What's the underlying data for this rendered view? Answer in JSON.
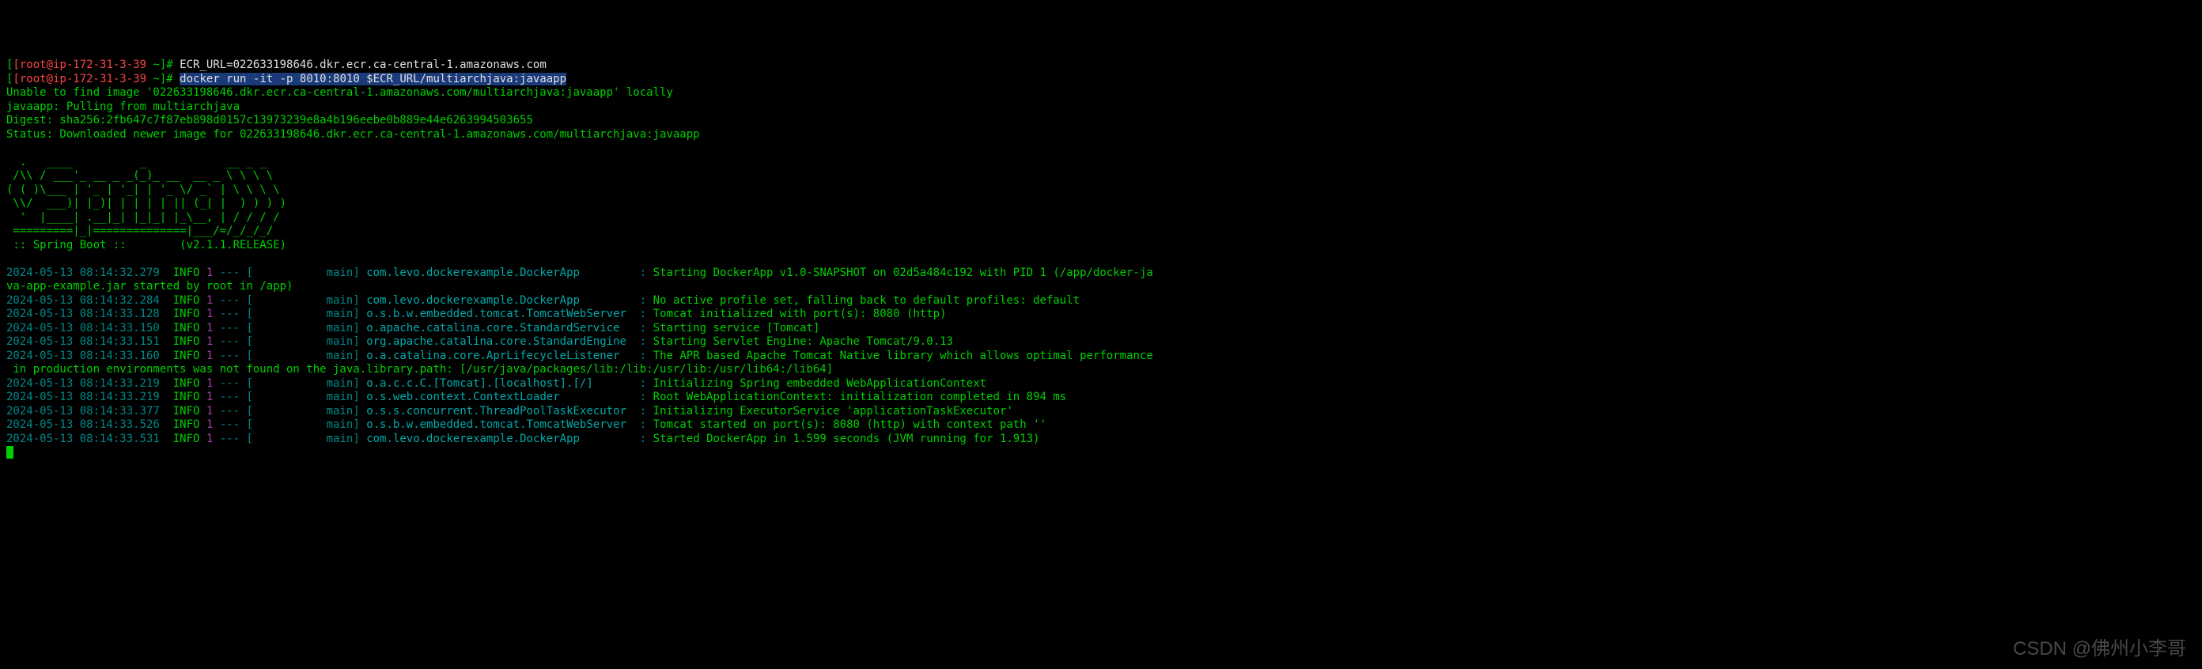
{
  "prompt1": {
    "open": "[",
    "user": "[root@ip-172-31-3-39",
    "sep": " ~]# ",
    "cmd": "ECR_URL=022633198646.dkr.ecr.ca-central-1.amazonaws.com"
  },
  "prompt2": {
    "open": "[",
    "user": "[root@ip-172-31-3-39",
    "sep": " ~]# ",
    "cmd": "docker run -it -p 8010:8010 $ECR_URL/multiarchjava:javaapp"
  },
  "output": {
    "l1": "Unable to find image '022633198646.dkr.ecr.ca-central-1.amazonaws.com/multiarchjava:javaapp' locally",
    "l2": "javaapp: Pulling from multiarchjava",
    "l3": "Digest: sha256:2fb647c7f87eb898d0157c13973239e8a4b196eebe0b889e44e6263994503655",
    "l4": "Status: Downloaded newer image for 022633198646.dkr.ecr.ca-central-1.amazonaws.com/multiarchjava:javaapp"
  },
  "ascii": {
    "l1": "  .   ____          _            __ _ _",
    "l2": " /\\\\ / ___'_ __ _ _(_)_ __  __ _ \\ \\ \\ \\",
    "l3": "( ( )\\___ | '_ | '_| | '_ \\/ _` | \\ \\ \\ \\",
    "l4": " \\\\/  ___)| |_)| | | | | || (_| |  ) ) ) )",
    "l5": "  '  |____| .__|_| |_|_| |_\\__, | / / / /",
    "l6": " =========|_|==============|___/=/_/_/_/",
    "l7": " :: Spring Boot ::        (v2.1.1.RELEASE)"
  },
  "logs": [
    {
      "ts": "2024-05-13 08:14:32.279",
      "level": "  INFO ",
      "pid": "1",
      "dash": " --- [",
      "thread": "           main] ",
      "logger": "com.levo.dockerexample.DockerApp        ",
      "colon": " : ",
      "msg": "Starting DockerApp v1.0-SNAPSHOT on 02d5a484c192 with PID 1 (/app/docker-ja"
    },
    {
      "cont": "va-app-example.jar started by root in /app)"
    },
    {
      "ts": "2024-05-13 08:14:32.284",
      "level": "  INFO ",
      "pid": "1",
      "dash": " --- [",
      "thread": "           main] ",
      "logger": "com.levo.dockerexample.DockerApp        ",
      "colon": " : ",
      "msg": "No active profile set, falling back to default profiles: default"
    },
    {
      "ts": "2024-05-13 08:14:33.128",
      "level": "  INFO ",
      "pid": "1",
      "dash": " --- [",
      "thread": "           main] ",
      "logger": "o.s.b.w.embedded.tomcat.TomcatWebServer ",
      "colon": " : ",
      "msg": "Tomcat initialized with port(s): 8080 (http)"
    },
    {
      "ts": "2024-05-13 08:14:33.150",
      "level": "  INFO ",
      "pid": "1",
      "dash": " --- [",
      "thread": "           main] ",
      "logger": "o.apache.catalina.core.StandardService  ",
      "colon": " : ",
      "msg": "Starting service [Tomcat]"
    },
    {
      "ts": "2024-05-13 08:14:33.151",
      "level": "  INFO ",
      "pid": "1",
      "dash": " --- [",
      "thread": "           main] ",
      "logger": "org.apache.catalina.core.StandardEngine ",
      "colon": " : ",
      "msg": "Starting Servlet Engine: Apache Tomcat/9.0.13"
    },
    {
      "ts": "2024-05-13 08:14:33.160",
      "level": "  INFO ",
      "pid": "1",
      "dash": " --- [",
      "thread": "           main] ",
      "logger": "o.a.catalina.core.AprLifecycleListener  ",
      "colon": " : ",
      "msg": "The APR based Apache Tomcat Native library which allows optimal performance"
    },
    {
      "cont": " in production environments was not found on the java.library.path: [/usr/java/packages/lib:/lib:/usr/lib:/usr/lib64:/lib64]"
    },
    {
      "ts": "2024-05-13 08:14:33.219",
      "level": "  INFO ",
      "pid": "1",
      "dash": " --- [",
      "thread": "           main] ",
      "logger": "o.a.c.c.C.[Tomcat].[localhost].[/]      ",
      "colon": " : ",
      "msg": "Initializing Spring embedded WebApplicationContext"
    },
    {
      "ts": "2024-05-13 08:14:33.219",
      "level": "  INFO ",
      "pid": "1",
      "dash": " --- [",
      "thread": "           main] ",
      "logger": "o.s.web.context.ContextLoader           ",
      "colon": " : ",
      "msg": "Root WebApplicationContext: initialization completed in 894 ms"
    },
    {
      "ts": "2024-05-13 08:14:33.377",
      "level": "  INFO ",
      "pid": "1",
      "dash": " --- [",
      "thread": "           main] ",
      "logger": "o.s.s.concurrent.ThreadPoolTaskExecutor ",
      "colon": " : ",
      "msg": "Initializing ExecutorService 'applicationTaskExecutor'"
    },
    {
      "ts": "2024-05-13 08:14:33.526",
      "level": "  INFO ",
      "pid": "1",
      "dash": " --- [",
      "thread": "           main] ",
      "logger": "o.s.b.w.embedded.tomcat.TomcatWebServer ",
      "colon": " : ",
      "msg": "Tomcat started on port(s): 8080 (http) with context path ''"
    },
    {
      "ts": "2024-05-13 08:14:33.531",
      "level": "  INFO ",
      "pid": "1",
      "dash": " --- [",
      "thread": "           main] ",
      "logger": "com.levo.dockerexample.DockerApp        ",
      "colon": " : ",
      "msg": "Started DockerApp in 1.599 seconds (JVM running for 1.913)"
    }
  ],
  "watermark": "CSDN @佛州小李哥"
}
